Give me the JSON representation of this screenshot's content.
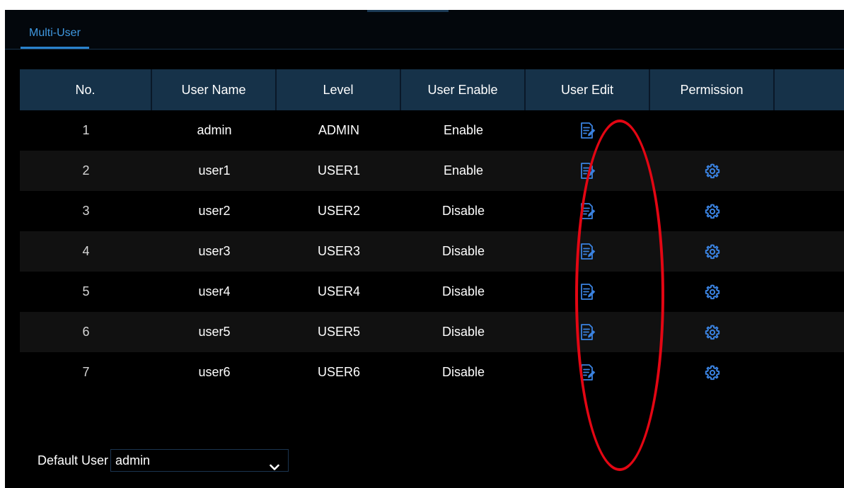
{
  "tabs": [
    {
      "label": "Multi-User",
      "active": true
    }
  ],
  "table": {
    "columns": [
      "No.",
      "User Name",
      "Level",
      "User Enable",
      "User Edit",
      "Permission",
      ""
    ],
    "rows": [
      {
        "no": "1",
        "user_name": "admin",
        "level": "ADMIN",
        "user_enable": "Enable",
        "edit_icon": "edit-icon",
        "permission_icon": null
      },
      {
        "no": "2",
        "user_name": "user1",
        "level": "USER1",
        "user_enable": "Enable",
        "edit_icon": "edit-icon",
        "permission_icon": "gear-icon"
      },
      {
        "no": "3",
        "user_name": "user2",
        "level": "USER2",
        "user_enable": "Disable",
        "edit_icon": "edit-icon",
        "permission_icon": "gear-icon"
      },
      {
        "no": "4",
        "user_name": "user3",
        "level": "USER3",
        "user_enable": "Disable",
        "edit_icon": "edit-icon",
        "permission_icon": "gear-icon"
      },
      {
        "no": "5",
        "user_name": "user4",
        "level": "USER4",
        "user_enable": "Disable",
        "edit_icon": "edit-icon",
        "permission_icon": "gear-icon"
      },
      {
        "no": "6",
        "user_name": "user5",
        "level": "USER5",
        "user_enable": "Disable",
        "edit_icon": "edit-icon",
        "permission_icon": "gear-icon"
      },
      {
        "no": "7",
        "user_name": "user6",
        "level": "USER6",
        "user_enable": "Disable",
        "edit_icon": "edit-icon",
        "permission_icon": "gear-icon"
      }
    ]
  },
  "default_user": {
    "label": "Default User",
    "value": "admin",
    "icon": "chevron-down-icon"
  },
  "colors": {
    "accent": "#2a82cc",
    "header_bg": "#163249",
    "annotation": "#e30613"
  }
}
